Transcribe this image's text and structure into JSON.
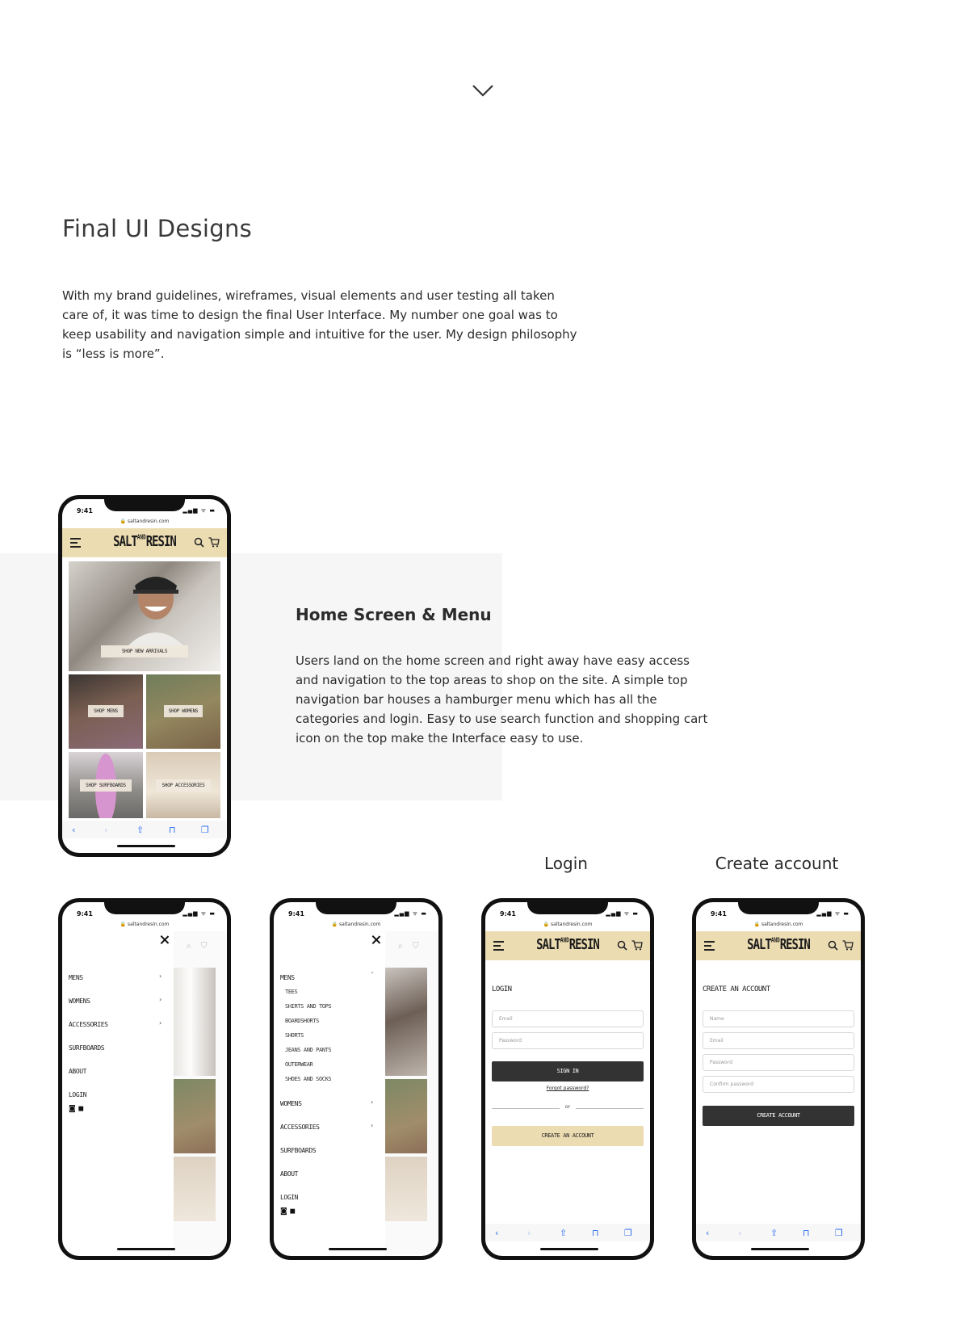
{
  "intro": {
    "title": "Final UI Designs",
    "paragraph": "With my brand guidelines, wireframes, visual elements and user testing all taken care of, it was time to design the final User Interface. My number one goal was to keep usability and navigation simple and intuitive for the user. My design philosophy is “less is more”."
  },
  "home_section": {
    "title": "Home Screen & Menu",
    "paragraph": "Users land on the home screen and right away have easy access and navigation to the top areas to shop on the site. A simple top navigation bar houses a hamburger menu which has all the categories and login. Easy to use search function and shopping cart icon on the top make the Interface easy to use."
  },
  "labels": {
    "login": "Login",
    "create_account": "Create account"
  },
  "phone": {
    "time": "9:41",
    "url": "saltandresin.com",
    "status_icons": "▂▄▆ ᯤ ▬",
    "logo_left": "SALT",
    "logo_amp": "AND",
    "logo_right": "RESIN",
    "browser_icons": [
      "‹",
      "›",
      "⇧",
      "⊓",
      "❐"
    ]
  },
  "home_tiles": {
    "new_arrivals": "SHOP NEW ARRIVALS",
    "mens": "SHOP MENS",
    "womens": "SHOP WOMENS",
    "surfboards": "SHOP SURFBOARDS",
    "accessories": "SHOP ACCESSORIES"
  },
  "menu": {
    "items": [
      "MENS",
      "WOMENS",
      "ACCESSORIES",
      "SURFBOARDS",
      "ABOUT",
      "LOGIN"
    ],
    "mens_sub": [
      "TEES",
      "SHIRTS AND TOPS",
      "BOARDSHORTS",
      "SHORTS",
      "JEANS AND PANTS",
      "OUTERWEAR",
      "SHOES AND SOCKS"
    ],
    "social_icons": [
      "instagram-icon",
      "facebook-icon"
    ]
  },
  "login": {
    "heading": "LOGIN",
    "email_placeholder": "Email",
    "password_placeholder": "Password",
    "sign_in": "SIGN IN",
    "forgot": "Forgot password?",
    "or": "or",
    "create": "CREATE AN ACCOUNT"
  },
  "create": {
    "heading": "CREATE AN ACCOUNT",
    "name_placeholder": "Name",
    "email_placeholder": "Email",
    "password_placeholder": "Password",
    "confirm_placeholder": "Confirm password",
    "create": "CREATE ACCOUNT"
  },
  "colors": {
    "accent_tan": "#ecdcb2",
    "dark_button": "#333333",
    "browser_blue": "#2b6df0"
  }
}
